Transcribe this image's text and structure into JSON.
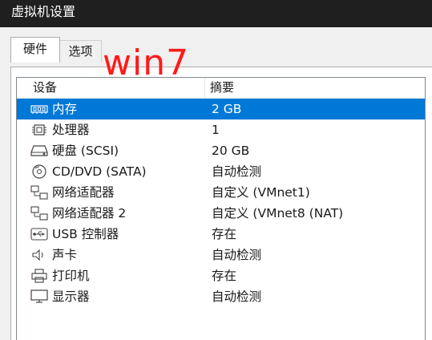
{
  "window": {
    "title": "虚拟机设置"
  },
  "tabs": [
    {
      "label": "硬件",
      "active": true
    },
    {
      "label": "选项",
      "active": false
    }
  ],
  "overlay": {
    "text": "win7",
    "color": "#ff1a1a"
  },
  "table": {
    "headers": {
      "device": "设备",
      "summary": "摘要"
    },
    "selected_index": 0,
    "rows": [
      {
        "icon": "memory-icon",
        "device": "内存",
        "summary": "2 GB"
      },
      {
        "icon": "cpu-icon",
        "device": "处理器",
        "summary": "1"
      },
      {
        "icon": "hard-disk-icon",
        "device": "硬盘 (SCSI)",
        "summary": "20 GB"
      },
      {
        "icon": "cd-dvd-icon",
        "device": "CD/DVD (SATA)",
        "summary": "自动检测"
      },
      {
        "icon": "network-adapter-icon",
        "device": "网络适配器",
        "summary": "自定义 (VMnet1)"
      },
      {
        "icon": "network-adapter-icon",
        "device": "网络适配器 2",
        "summary": "自定义 (VMnet8 (NAT)"
      },
      {
        "icon": "usb-icon",
        "device": "USB 控制器",
        "summary": "存在"
      },
      {
        "icon": "sound-card-icon",
        "device": "声卡",
        "summary": "自动检测"
      },
      {
        "icon": "printer-icon",
        "device": "打印机",
        "summary": "存在"
      },
      {
        "icon": "display-icon",
        "device": "显示器",
        "summary": "自动检测"
      }
    ]
  },
  "colors": {
    "selection": "#0078d7",
    "titlebar": "#1f1f1f"
  }
}
